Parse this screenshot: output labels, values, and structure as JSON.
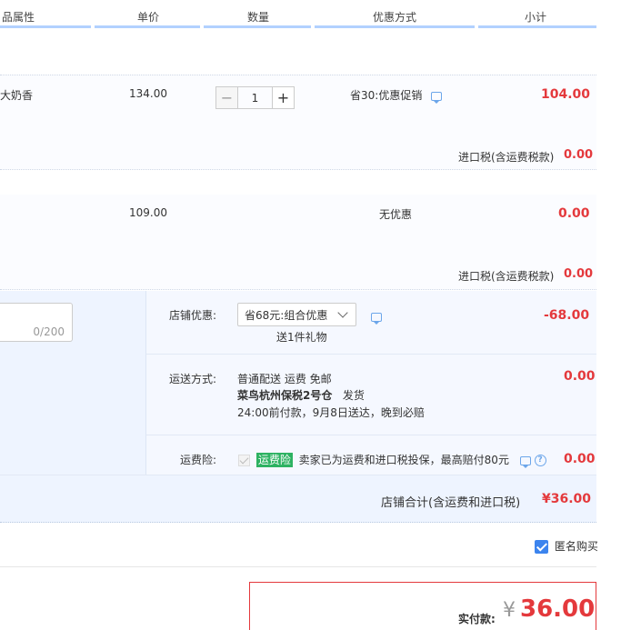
{
  "header": {
    "col_props": "品属性",
    "col_price": "单价",
    "col_qty": "数量",
    "col_discount": "优惠方式",
    "col_subtotal": "小计"
  },
  "items": [
    {
      "props": "大奶香",
      "price": "134.00",
      "qty": "1",
      "qty_minus": "−",
      "qty_plus": "+",
      "discount": "省30:优惠促销",
      "subtotal": "104.00",
      "tax_label": "进口税(含运费税款)",
      "tax_value": "0.00"
    },
    {
      "price": "109.00",
      "discount": "无优惠",
      "subtotal": "0.00",
      "tax_label": "进口税(含运费税款)",
      "tax_value": "0.00"
    }
  ],
  "order": {
    "memo_counter": "0/200",
    "shop_discount_label": "店铺优惠:",
    "shop_discount_selected": "省68元:组合优惠",
    "gift_text": "送1件礼物",
    "shop_discount_value": "-68.00",
    "shipping_label": "运送方式:",
    "shipping_method": "普通配送 运费 免邮",
    "warehouse_name": "菜鸟杭州保税2号仓",
    "warehouse_suffix": "发货",
    "delivery_note": "24:00前付款，9月8日送达，晚到必赔",
    "shipping_value": "0.00",
    "insurance_label": "运费险:",
    "insurance_tag": "运费险",
    "insurance_text": "卖家已为运费和进口税投保，最高赔付80元",
    "insurance_value": "0.00",
    "qmark": "?",
    "shop_total_label": "店铺合计(含运费和进口税)",
    "shop_total_value": "¥36.00"
  },
  "anonymous_label": "匿名购买",
  "payment": {
    "label": "实付款:",
    "currency": "¥",
    "amount": "36.00"
  },
  "colors": {
    "accent_red": "#e4393c",
    "header_line": "#b2d1ff",
    "checkbox_blue": "#3c84ee",
    "tag_green": "#2db262"
  },
  "icons": [
    "minus-icon",
    "plus-icon",
    "chat-icon",
    "chevron-down-icon",
    "check-icon",
    "help-icon",
    "checkbox-checked-icon"
  ]
}
